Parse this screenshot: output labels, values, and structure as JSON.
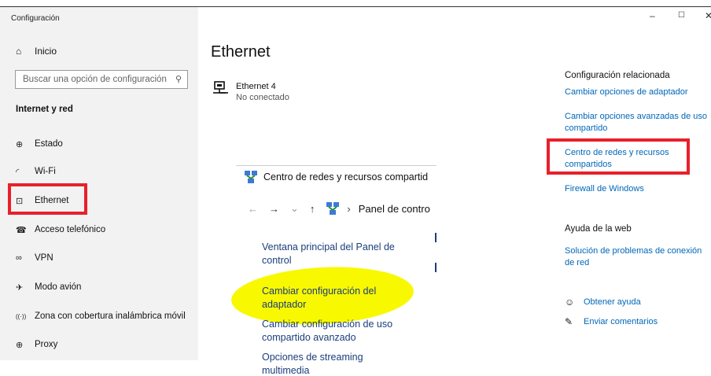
{
  "window": {
    "title": "Configuración",
    "minimize": "–",
    "maximize": "☐",
    "close": "✕"
  },
  "sidebar": {
    "home": {
      "label": "Inicio",
      "icon": "home-icon",
      "glyph": "⌂"
    },
    "search_placeholder": "Buscar una opción de configuración",
    "search_glyph": "⚲",
    "section": "Internet y red",
    "items": [
      {
        "label": "Estado",
        "icon": "globe-icon",
        "glyph": "⊕"
      },
      {
        "label": "Wi-Fi",
        "icon": "wifi-icon",
        "glyph": "◜"
      },
      {
        "label": "Ethernet",
        "icon": "ethernet-icon",
        "glyph": "⊡"
      },
      {
        "label": "Acceso telefónico",
        "icon": "dialup-icon",
        "glyph": "☎"
      },
      {
        "label": "VPN",
        "icon": "vpn-icon",
        "glyph": "∞"
      },
      {
        "label": "Modo avión",
        "icon": "airplane-icon",
        "glyph": "✈"
      },
      {
        "label": "Zona con cobertura inalámbrica móvil",
        "icon": "hotspot-icon",
        "glyph": "((·))"
      },
      {
        "label": "Proxy",
        "icon": "proxy-icon",
        "glyph": "⊕"
      }
    ]
  },
  "main": {
    "title": "Ethernet",
    "adapter": {
      "name": "Ethernet 4",
      "status": "No conectado"
    }
  },
  "control_panel": {
    "title": "Centro de redes y recursos compartid",
    "nav": {
      "back": "←",
      "forward": "→",
      "dropdown": "⌄",
      "up": "↑",
      "sep": "›",
      "address": "Panel de contro"
    },
    "links": [
      "Ventana principal del Panel de control",
      "Cambiar configuración del adaptador",
      "Cambiar configuración de uso compartido avanzado",
      "Opciones de streaming multimedia"
    ]
  },
  "related": {
    "heading": "Configuración relacionada",
    "links": [
      "Cambiar opciones de adaptador",
      "Cambiar opciones avanzadas de uso compartido",
      "Centro de redes y recursos compartidos",
      "Firewall de Windows"
    ]
  },
  "web_help": {
    "heading": "Ayuda de la web",
    "link": "Solución de problemas de conexión de red"
  },
  "support": {
    "help": {
      "label": "Obtener ayuda",
      "icon": "help-chat-icon",
      "glyph": "☺"
    },
    "feedback": {
      "label": "Enviar comentarios",
      "icon": "feedback-icon",
      "glyph": "✎"
    }
  },
  "colors": {
    "accent": "#0067b8",
    "highlight_red": "#e8202a",
    "highlight_yellow": "#f8f800"
  }
}
